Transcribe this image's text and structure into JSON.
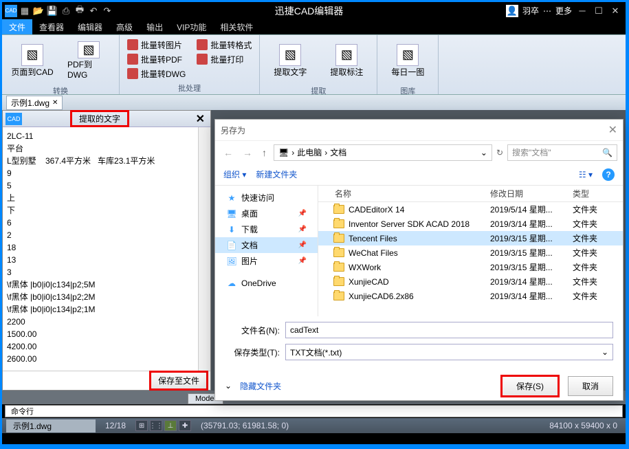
{
  "app": {
    "title": "迅捷CAD编辑器"
  },
  "titlebar_right": {
    "user": "羽卒",
    "more": "更多"
  },
  "menus": [
    "文件",
    "查看器",
    "编辑器",
    "高级",
    "输出",
    "VIP功能",
    "相关软件"
  ],
  "active_menu_index": 0,
  "ribbon": {
    "groups": [
      {
        "label": "转换",
        "big": [
          {
            "label": "页面到CAD"
          },
          {
            "label": "PDF到DWG"
          }
        ],
        "small": []
      },
      {
        "label": "批处理",
        "big": [],
        "small": [
          [
            "批量转图片",
            "批量转PDF",
            "批量转DWG"
          ],
          [
            "批量转格式",
            "批量打印",
            ""
          ]
        ]
      },
      {
        "label": "提取",
        "big": [
          {
            "label": "提取文字"
          },
          {
            "label": "提取标注"
          }
        ],
        "small": []
      },
      {
        "label": "图库",
        "big": [
          {
            "label": "每日一图"
          }
        ],
        "small": []
      }
    ]
  },
  "doc_tab": "示例1.dwg",
  "extract_panel": {
    "title": "提取的文字",
    "lines": [
      "2LC-11",
      "平台",
      "L型别墅    367.4平方米   车库23.1平方米",
      "9",
      "5",
      "上",
      "下",
      "6",
      "2",
      "18",
      "13",
      "3",
      "\\f黑体 |b0|i0|c134|p2;5M",
      "\\f黑体 |b0|i0|c134|p2;2M",
      "\\f黑体 |b0|i0|c134|p2;1M",
      "2200",
      "1500.00",
      "4200.00",
      "2600.00"
    ],
    "save_btn": "保存至文件"
  },
  "dialog": {
    "title": "另存为",
    "path": [
      "此电脑",
      "文档"
    ],
    "search_placeholder": "搜索\"文档\"",
    "toolbar": {
      "organize": "组织",
      "new_folder": "新建文件夹"
    },
    "side": {
      "quick": "快速访问",
      "desktop": "桌面",
      "downloads": "下载",
      "documents": "文档",
      "pictures": "图片",
      "onedrive": "OneDrive"
    },
    "columns": {
      "name": "名称",
      "date": "修改日期",
      "type": "类型"
    },
    "files": [
      {
        "name": "CADEditorX 14",
        "date": "2019/5/14 星期...",
        "type": "文件夹"
      },
      {
        "name": "Inventor Server SDK ACAD 2018",
        "date": "2019/3/14 星期...",
        "type": "文件夹"
      },
      {
        "name": "Tencent Files",
        "date": "2019/3/15 星期...",
        "type": "文件夹",
        "sel": true
      },
      {
        "name": "WeChat Files",
        "date": "2019/3/15 星期...",
        "type": "文件夹"
      },
      {
        "name": "WXWork",
        "date": "2019/3/15 星期...",
        "type": "文件夹"
      },
      {
        "name": "XunjieCAD",
        "date": "2019/3/14 星期...",
        "type": "文件夹"
      },
      {
        "name": "XunjieCAD6.2x86",
        "date": "2019/3/14 星期...",
        "type": "文件夹"
      }
    ],
    "filename_label": "文件名(N):",
    "filename": "cadText",
    "filetype_label": "保存类型(T):",
    "filetype": "TXT文档(*.txt)",
    "hide_folders": "隐藏文件夹",
    "save_btn": "保存(S)",
    "cancel_btn": "取消"
  },
  "bottom_tab": "Model",
  "cmdline": "命令行",
  "status": {
    "file": "示例1.dwg",
    "pages": "12/18",
    "coords": "(35791.03; 61981.58; 0)",
    "dims": "84100 x 59400 x 0"
  }
}
